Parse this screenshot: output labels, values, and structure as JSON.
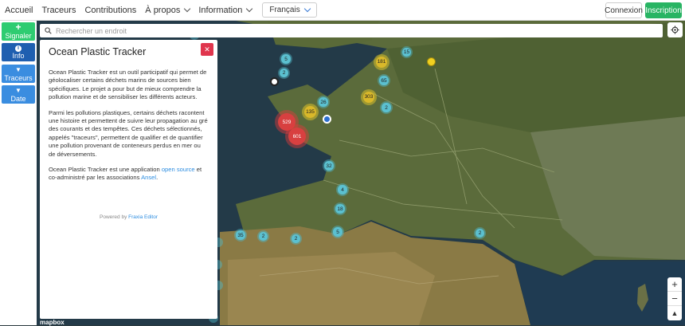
{
  "nav": {
    "home": "Accueil",
    "trackers": "Traceurs",
    "contributions": "Contributions",
    "about": "À propos",
    "information": "Information",
    "language": "Français",
    "login": "Connexion",
    "signup": "Inscription"
  },
  "sidebar": {
    "report": {
      "icon": "+",
      "label": "Signaler"
    },
    "info": {
      "icon": "i",
      "label": "Info"
    },
    "trackers": {
      "icon": "▼",
      "label": "Traceurs"
    },
    "date": {
      "icon": "▼",
      "label": "Date"
    }
  },
  "colors": {
    "report": "#2ecc71",
    "active": "#1f5fb0",
    "filter": "#3a8de0",
    "close": "#e0354d"
  },
  "search": {
    "placeholder": "Rechercher un endroit"
  },
  "panel": {
    "title": "Ocean Plastic Tracker",
    "close_icon": "✕",
    "p1": "Ocean Plastic Tracker est un outil participatif qui permet de géolocaliser certains déchets marins de sources bien spécifiques. Le projet a pour but de mieux comprendre la pollution marine et de sensibiliser les différents acteurs.",
    "p2": "Parmi les pollutions plastiques, certains déchets racontent une histoire et permettent de suivre leur propagation au gré des courants et des tempêtes. Ces déchets sélectionnés, appelés \"traceurs\", permettent de qualifier et de quantifier une pollution provenant de conteneurs perdus en mer ou de déversements.",
    "p3_before": "Ocean Plastic Tracker est une application ",
    "p3_link1": "open source",
    "p3_middle": " et co-administré par les associations ",
    "p3_link2": "Ansel",
    "p3_after": ".",
    "powered_before": "Powered by ",
    "powered_link": "Fraxia Editor"
  },
  "map": {
    "zoom_in": "+",
    "zoom_out": "−",
    "compass": "▲",
    "logo": "mapbox",
    "clusters": [
      {
        "label": "5",
        "color": "teal"
      },
      {
        "label": "2",
        "color": "teal"
      },
      {
        "label": "181",
        "color": "yellow"
      },
      {
        "label": "15",
        "color": "teal"
      },
      {
        "label": "65",
        "color": "teal"
      },
      {
        "label": "303",
        "color": "yellow"
      },
      {
        "label": "2",
        "color": "teal"
      },
      {
        "label": "26",
        "color": "teal"
      },
      {
        "label": "135",
        "color": "yellow"
      },
      {
        "label": "529",
        "color": "red"
      },
      {
        "label": "601",
        "color": "red"
      },
      {
        "label": "32",
        "color": "teal"
      },
      {
        "label": "4",
        "color": "teal"
      },
      {
        "label": "18",
        "color": "teal"
      },
      {
        "label": "5",
        "color": "teal"
      },
      {
        "label": "35",
        "color": "teal"
      },
      {
        "label": "2",
        "color": "teal"
      },
      {
        "label": "2",
        "color": "teal"
      },
      {
        "label": "2",
        "color": "teal"
      }
    ]
  }
}
